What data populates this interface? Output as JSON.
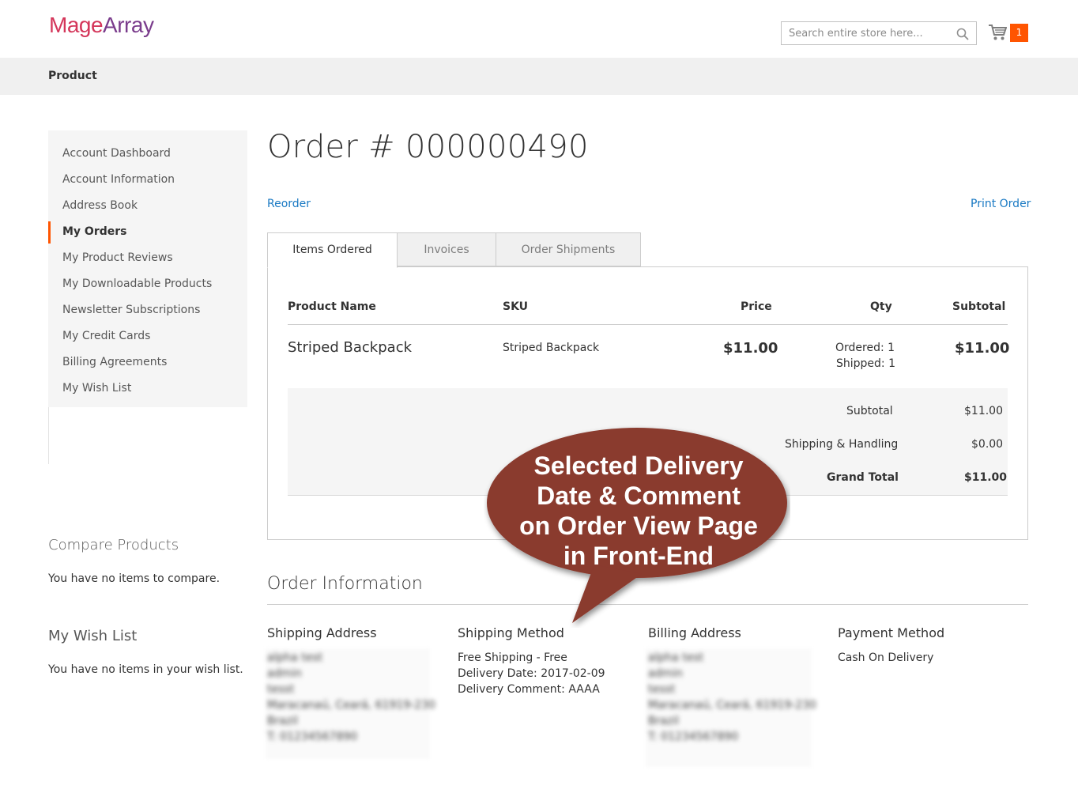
{
  "header": {
    "logo_part1": "Mage",
    "logo_part2": "Array",
    "search_placeholder": "Search entire store here...",
    "cart_count": "1"
  },
  "nav": {
    "product": "Product"
  },
  "sidebar": {
    "items": [
      {
        "label": "Account Dashboard"
      },
      {
        "label": "Account Information"
      },
      {
        "label": "Address Book"
      },
      {
        "label": "My Orders",
        "active": true
      },
      {
        "label": "My Product Reviews"
      },
      {
        "label": "My Downloadable Products"
      },
      {
        "label": "Newsletter Subscriptions"
      },
      {
        "label": "My Credit Cards"
      },
      {
        "label": "Billing Agreements"
      },
      {
        "label": "My Wish List"
      }
    ],
    "compare_title": "Compare Products",
    "compare_text": "You have no items to compare.",
    "wish_title": "My Wish List",
    "wish_text": "You have no items in your wish list."
  },
  "order": {
    "title": "Order # 000000490",
    "reorder": "Reorder",
    "print": "Print Order",
    "tabs": [
      "Items Ordered",
      "Invoices",
      "Order Shipments"
    ],
    "columns": [
      "Product Name",
      "SKU",
      "Price",
      "Qty",
      "Subtotal"
    ],
    "item": {
      "name": "Striped Backpack",
      "sku": "Striped Backpack",
      "price": "$11.00",
      "qty_ordered": "Ordered: 1",
      "qty_shipped": "Shipped: 1",
      "subtotal": "$11.00"
    },
    "totals": [
      {
        "label": "Subtotal",
        "value": "$11.00"
      },
      {
        "label": "Shipping & Handling",
        "value": "$0.00"
      },
      {
        "label": "Grand Total",
        "value": "$11.00"
      }
    ]
  },
  "info": {
    "title": "Order Information",
    "shipping_address": {
      "title": "Shipping Address",
      "lines": [
        "alpha test",
        "admin",
        "tesst",
        "Maracanaú, Ceará, 61919-230",
        "Brazil",
        "T: 01234567890"
      ]
    },
    "shipping_method": {
      "title": "Shipping Method",
      "lines": [
        "Free Shipping - Free",
        "Delivery Date: 2017-02-09",
        "Delivery Comment: AAAA"
      ]
    },
    "billing_address": {
      "title": "Billing Address",
      "lines": [
        "alpha test",
        "admin",
        "tesst",
        "Maracanaú, Ceará, 61919-230",
        "Brazil",
        "T: 01234567890"
      ]
    },
    "payment_method": {
      "title": "Payment Method",
      "lines": [
        "Cash On Delivery"
      ]
    }
  },
  "callout": {
    "lines": [
      "Selected Delivery",
      "Date & Comment",
      "on Order View Page",
      "in Front-End"
    ]
  },
  "colors": {
    "accent": "#ff5501",
    "link": "#1979c3",
    "callout_fill": "#8a3a2f",
    "logo_pink": "#d4365a",
    "logo_purple": "#7a3c8c"
  }
}
